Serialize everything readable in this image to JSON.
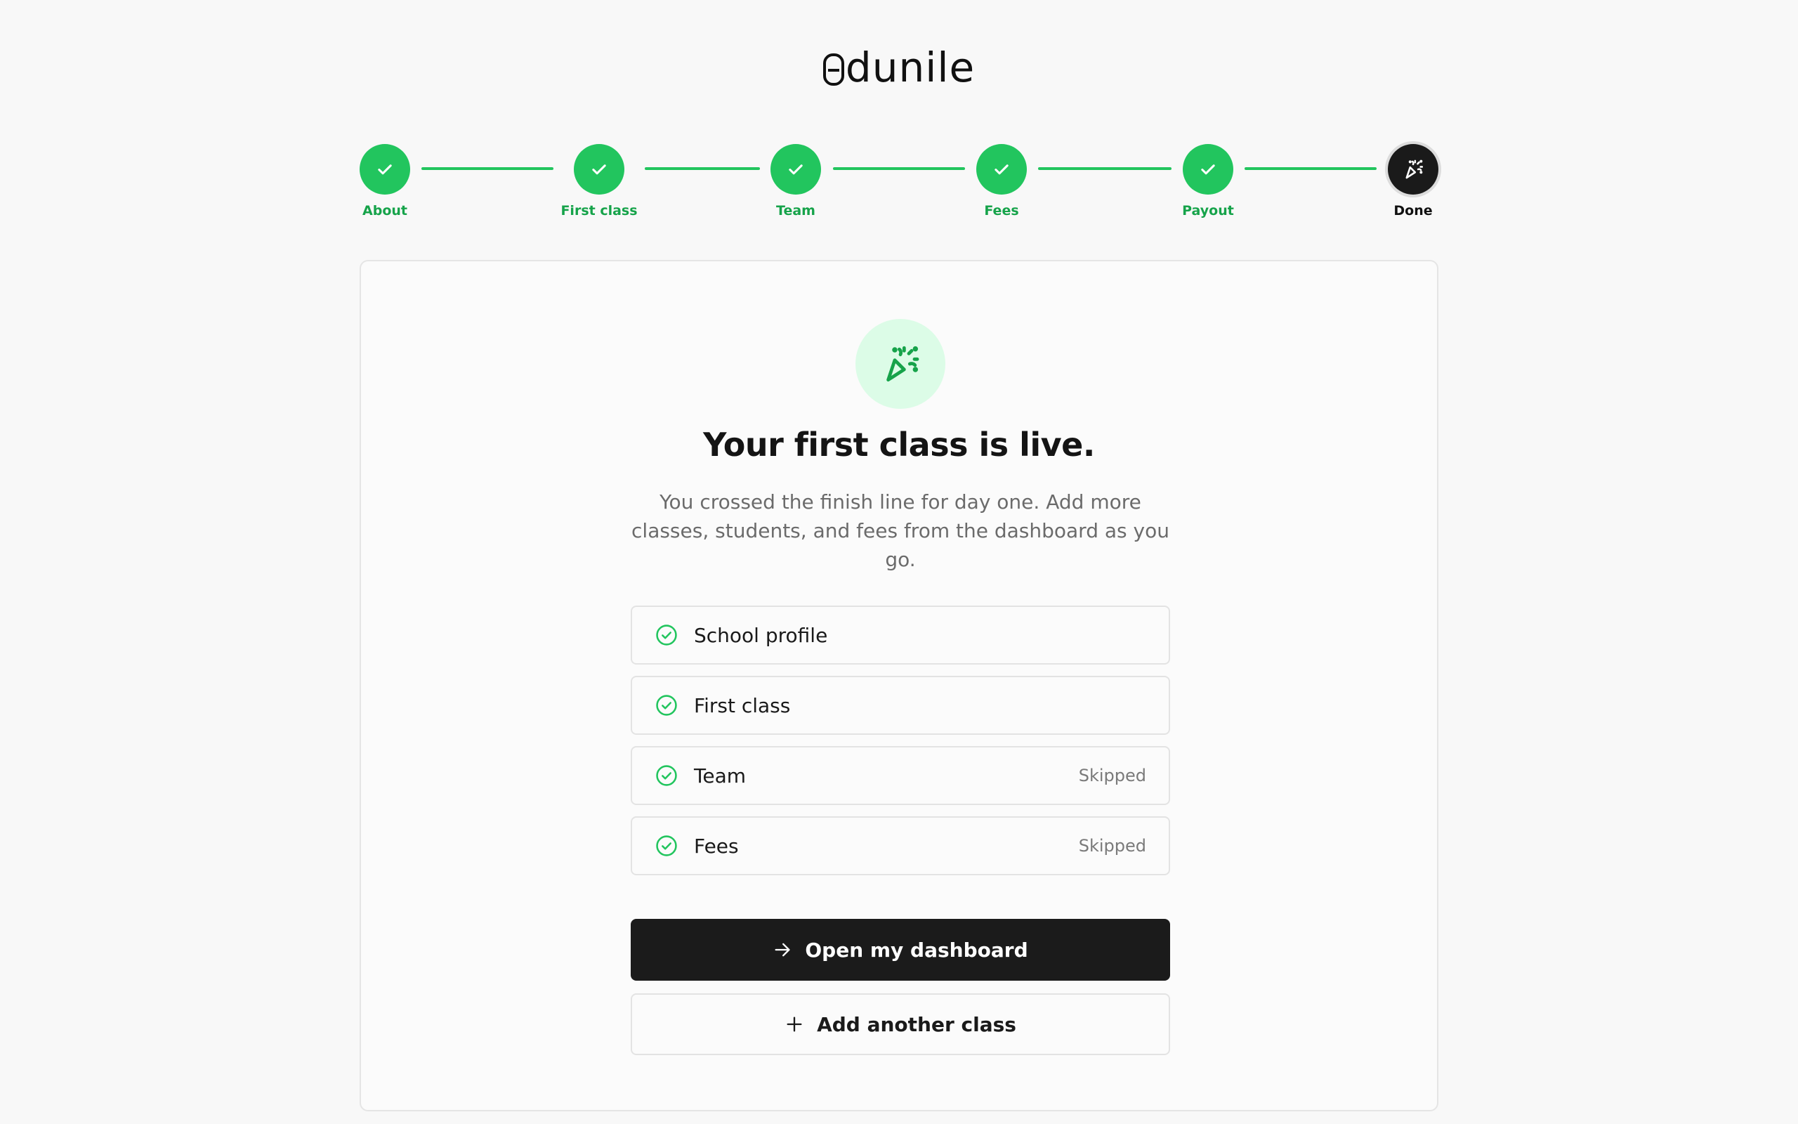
{
  "brand": {
    "logo_text": "dunile",
    "logo_mark": "e"
  },
  "stepper": {
    "steps": [
      {
        "label": "About",
        "status": "complete",
        "icon": "check-icon"
      },
      {
        "label": "First class",
        "status": "complete",
        "icon": "check-icon"
      },
      {
        "label": "Team",
        "status": "complete",
        "icon": "check-icon"
      },
      {
        "label": "Fees",
        "status": "complete",
        "icon": "check-icon"
      },
      {
        "label": "Payout",
        "status": "complete",
        "icon": "check-icon"
      },
      {
        "label": "Done",
        "status": "current",
        "icon": "party-popper-icon"
      }
    ]
  },
  "card": {
    "icon": "party-popper-icon",
    "title": "Your first class is live.",
    "subtitle": "You crossed the finish line for day one. Add more classes, students, and fees from the dashboard as you go.",
    "checklist": [
      {
        "label": "School profile",
        "status": ""
      },
      {
        "label": "First class",
        "status": ""
      },
      {
        "label": "Team",
        "status": "Skipped"
      },
      {
        "label": "Fees",
        "status": "Skipped"
      }
    ],
    "primary_button": {
      "label": "Open my dashboard",
      "icon": "arrow-right-icon"
    },
    "secondary_button": {
      "label": "Add another class",
      "icon": "plus-icon"
    }
  },
  "colors": {
    "accent_green": "#22c55e",
    "accent_green_text": "#16a34a",
    "hero_bg": "#dcfce7",
    "primary_button_bg": "#1b1b1b",
    "page_bg": "#f8f8f8"
  }
}
